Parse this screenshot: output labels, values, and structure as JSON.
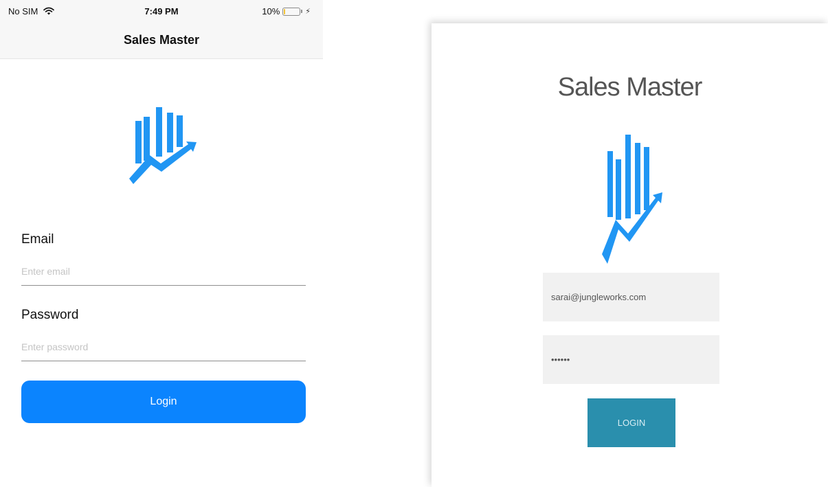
{
  "ios": {
    "status_bar": {
      "carrier": "No SIM",
      "time": "7:49 PM",
      "battery": "10%",
      "battery_level": 0.1
    },
    "nav_title": "Sales Master",
    "email": {
      "label": "Email",
      "placeholder": "Enter email"
    },
    "password": {
      "label": "Password",
      "placeholder": "Enter password"
    },
    "login_label": "Login",
    "accent_color": "#0b84fe",
    "icons": [
      "wifi-icon",
      "battery-icon",
      "charging-bolt-icon",
      "sales-chart-logo-icon"
    ]
  },
  "android": {
    "title": "Sales Master",
    "email_value": "sarai@jungleworks.com",
    "password_value": "••••••",
    "login_label": "LOGIN",
    "accent_color": "#2a8fad",
    "icons": [
      "sales-chart-logo-icon"
    ]
  }
}
